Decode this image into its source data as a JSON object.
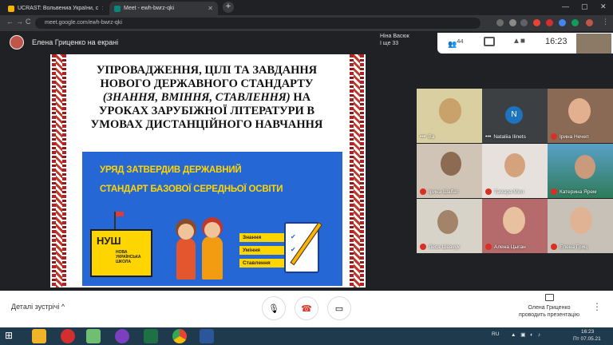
{
  "browser": {
    "tabs": [
      {
        "label": "UCRAST: Вольвениа України, с",
        "active": false
      },
      {
        "label": "Meet - ewh-bwrz-qki",
        "active": true
      }
    ],
    "new_tab": "+",
    "window_controls": {
      "minimize": "—",
      "maximize": "▢",
      "close": "✕"
    },
    "nav": {
      "back": "←",
      "forward": "→",
      "reload": "C"
    },
    "url": "meet.google.com/ewh-bwrz-qki"
  },
  "meet": {
    "presenter_banner": "Елена Гриценко на екрані",
    "overlay_name_line1": "Ніна Васюк",
    "overlay_name_line2": "І ще 33",
    "participants_count": "44",
    "time": "16:23",
    "slide": {
      "title_line1": "УПРОВАДЖЕННЯ, ЦІЛІ ТА ЗАВДАННЯ",
      "title_line2": "НОВОГО ДЕРЖАВНОГО СТАНДАРТУ",
      "title_line3": "(ЗНАННЯ, ВМІННЯ, СТАВЛЕННЯ)",
      "title_line4": "НА",
      "title_line5": "УРОКАХ ЗАРУБІЖНОЇ ЛІТЕРАТУРИ В",
      "title_line6": "УМОВАХ ДИСТАНЦІЙНОГО НАВЧАННЯ",
      "banner_line1": "УРЯД ЗАТВЕРДИВ ДЕРЖАВНИЙ",
      "banner_line2": "СТАНДАРТ БАЗОВОЇ СЕРЕДНЬОЇ ОСВІТИ",
      "logo_big": "НУШ",
      "logo_small": "НОВА УКРАЇНСЬКА ШКОЛА",
      "checklist": [
        "Знання",
        "Уміння",
        "Ставлення"
      ]
    },
    "tiles": [
      {
        "name": "Ва",
        "muted": false
      },
      {
        "name": "Nataliia Ilinets",
        "muted": false,
        "initial": "N"
      },
      {
        "name": "Ірина Нечеп",
        "muted": true
      },
      {
        "name": "Ірина Шабат",
        "muted": true
      },
      {
        "name": "Тамара Мил",
        "muted": true
      },
      {
        "name": "Катерина Ярем",
        "muted": true
      },
      {
        "name": "Леся Шевчук",
        "muted": true
      },
      {
        "name": "Алена Цыган",
        "muted": true
      },
      {
        "name": "Елена Гриц",
        "muted": true
      }
    ],
    "bottom": {
      "details_label": "Деталі зустрічі",
      "details_chevron": "^",
      "mic": "🎙",
      "end": "☎",
      "camera": "▭",
      "presenting_line1": "Олена Гриценко",
      "presenting_line2": "проводить презентацію",
      "more": "⋮"
    }
  },
  "taskbar": {
    "lang": "RU",
    "clock": "16:23",
    "date": "Пт 07.05.21"
  },
  "colors": {
    "slide_banner": "#2667d6",
    "banner_text": "#ffd500",
    "end_call": "#d93025"
  }
}
